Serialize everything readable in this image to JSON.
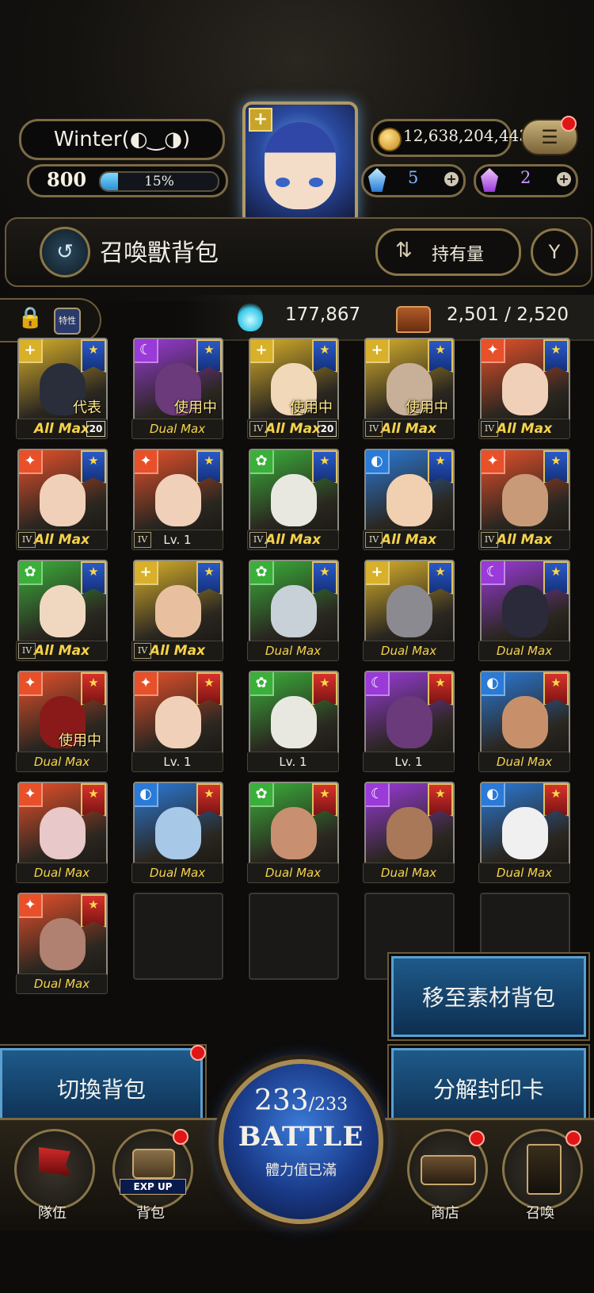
{
  "player": {
    "name": "Winter(◐‿◑)",
    "level": "800",
    "exp_percent_text": "15%",
    "exp_fraction": 0.15
  },
  "currency": {
    "gold": "12,638,204,443",
    "blue_gem": "5",
    "purple_gem": "2"
  },
  "header": {
    "title": "召喚獸背包",
    "sort_label": "持有量"
  },
  "stats": {
    "trait_label": "特性",
    "soul_count": "177,867",
    "capacity": "2,501 / 2,520"
  },
  "cards": [
    {
      "element": "light",
      "rank": "blue",
      "roman": "",
      "level": "All Max",
      "badge": "20",
      "tag": "代表",
      "skin": "#2a2d3a"
    },
    {
      "element": "dark",
      "rank": "blue",
      "roman": "",
      "level": "Dual Max",
      "badge": "",
      "tag": "使用中",
      "skin": "#6a3a7a"
    },
    {
      "element": "light",
      "rank": "blue",
      "roman": "IV",
      "level": "All Max",
      "badge": "20",
      "tag": "使用中",
      "skin": "#f0d8b8"
    },
    {
      "element": "light",
      "rank": "blue",
      "roman": "IV",
      "level": "All Max",
      "badge": "",
      "tag": "使用中",
      "skin": "#c8b098"
    },
    {
      "element": "fire",
      "rank": "blue",
      "roman": "IV",
      "level": "All Max",
      "badge": "",
      "tag": "",
      "skin": "#f0d0b8"
    },
    {
      "element": "fire",
      "rank": "blue",
      "roman": "IV",
      "level": "All Max",
      "badge": "",
      "tag": "",
      "skin": "#f0d0b8"
    },
    {
      "element": "fire",
      "rank": "blue",
      "roman": "IV",
      "level": "Lv. 1",
      "badge": "",
      "tag": "",
      "skin": "#f0d0b8"
    },
    {
      "element": "wood",
      "rank": "blue",
      "roman": "IV",
      "level": "All Max",
      "badge": "",
      "tag": "",
      "skin": "#e8e8e0"
    },
    {
      "element": "water",
      "rank": "blue",
      "roman": "IV",
      "level": "All Max",
      "badge": "",
      "tag": "",
      "skin": "#f0d0b0"
    },
    {
      "element": "fire",
      "rank": "blue",
      "roman": "IV",
      "level": "All Max",
      "badge": "",
      "tag": "",
      "skin": "#c89a78"
    },
    {
      "element": "wood",
      "rank": "blue",
      "roman": "IV",
      "level": "All Max",
      "badge": "",
      "tag": "",
      "skin": "#f0d8c0"
    },
    {
      "element": "light",
      "rank": "blue",
      "roman": "IV",
      "level": "All Max",
      "badge": "",
      "tag": "",
      "skin": "#e8c0a0"
    },
    {
      "element": "wood",
      "rank": "blue",
      "roman": "",
      "level": "Dual Max",
      "badge": "",
      "tag": "",
      "skin": "#c8d0d8"
    },
    {
      "element": "light",
      "rank": "blue",
      "roman": "",
      "level": "Dual Max",
      "badge": "",
      "tag": "",
      "skin": "#8a8a90"
    },
    {
      "element": "dark",
      "rank": "blue",
      "roman": "",
      "level": "Dual Max",
      "badge": "",
      "tag": "",
      "skin": "#2a2a3a"
    },
    {
      "element": "fire",
      "rank": "red",
      "roman": "",
      "level": "Dual Max",
      "badge": "",
      "tag": "使用中",
      "skin": "#8a1a1a"
    },
    {
      "element": "fire",
      "rank": "red",
      "roman": "",
      "level": "Lv. 1",
      "badge": "",
      "tag": "",
      "skin": "#f0d0b8"
    },
    {
      "element": "wood",
      "rank": "red",
      "roman": "",
      "level": "Lv. 1",
      "badge": "",
      "tag": "",
      "skin": "#e8e8e0"
    },
    {
      "element": "dark",
      "rank": "red",
      "roman": "",
      "level": "Lv. 1",
      "badge": "",
      "tag": "",
      "skin": "#6a3a7a"
    },
    {
      "element": "water",
      "rank": "red",
      "roman": "",
      "level": "Dual Max",
      "badge": "",
      "tag": "",
      "skin": "#c8906a"
    },
    {
      "element": "fire",
      "rank": "red",
      "roman": "",
      "level": "Dual Max",
      "badge": "",
      "tag": "",
      "skin": "#e8c8c8"
    },
    {
      "element": "water",
      "rank": "red",
      "roman": "",
      "level": "Dual Max",
      "badge": "",
      "tag": "",
      "skin": "#a8c8e8"
    },
    {
      "element": "wood",
      "rank": "red",
      "roman": "",
      "level": "Dual Max",
      "badge": "",
      "tag": "",
      "skin": "#c89070"
    },
    {
      "element": "dark",
      "rank": "red",
      "roman": "",
      "level": "Dual Max",
      "badge": "",
      "tag": "",
      "skin": "#a87858"
    },
    {
      "element": "water",
      "rank": "red",
      "roman": "",
      "level": "Dual Max",
      "badge": "",
      "tag": "",
      "skin": "#f0f0f0"
    },
    {
      "element": "fire",
      "rank": "red",
      "roman": "",
      "level": "Dual Max",
      "badge": "",
      "tag": "",
      "skin": "#b08070"
    }
  ],
  "element_colors": {
    "fire": "#e8502a",
    "water": "#2a7ad8",
    "wood": "#3ab03a",
    "light": "#d8b02a",
    "dark": "#9a3ad8"
  },
  "actions": {
    "move_to_material": "移至素材背包",
    "switch_bag": "切換背包",
    "decompose": "分解封印卡"
  },
  "battle": {
    "stamina_current": "233",
    "stamina_max": "/233",
    "label": "BATTLE",
    "status": "體力值已滿"
  },
  "nav": {
    "team": "隊伍",
    "exp_up": "EXP UP",
    "bag": "背包",
    "shop": "商店",
    "summon": "召喚"
  }
}
